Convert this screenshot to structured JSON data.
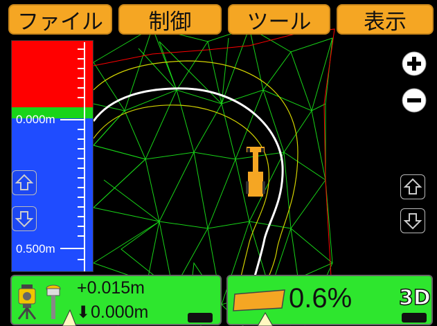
{
  "menu": {
    "file": "ファイル",
    "control": "制御",
    "tools": "ツール",
    "view": "表示"
  },
  "elevation": {
    "top_label": "0.000m",
    "bottom_label": "0.500m"
  },
  "status": {
    "offset": "+0.015m",
    "cut_fill": "0.000m",
    "slope": "0.6%",
    "view_mode": "3D"
  },
  "colors": {
    "menu_bg": "#f5a623",
    "cut": "#ff0000",
    "on_grade": "#18d418",
    "fill": "#1f4cff",
    "status_bg": "#2ee62e"
  },
  "icons": [
    "zoom-in-icon",
    "zoom-out-icon",
    "arrow-up-icon",
    "arrow-down-icon",
    "total-station-icon",
    "gps-receiver-icon",
    "machine-icon"
  ]
}
